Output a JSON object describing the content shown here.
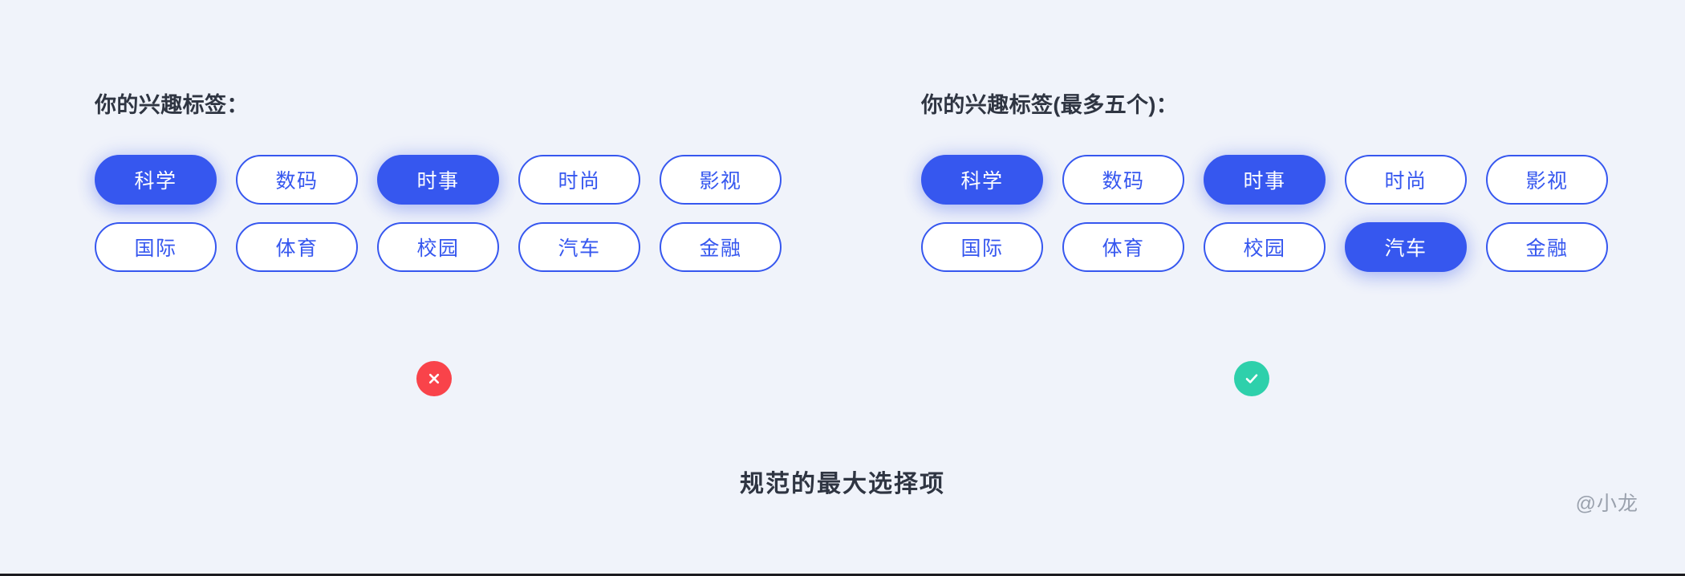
{
  "background_color": "#f0f3fa",
  "accent_color": "#3657ef",
  "caption": "规范的最大选择项",
  "watermark": "@小龙",
  "panels": [
    {
      "id": "invalid",
      "heading": "你的兴趣标签：",
      "verdict": "invalid",
      "verdict_icon": "close-icon",
      "verdict_color": "#f9434a",
      "chips": [
        {
          "label": "科学",
          "selected": true
        },
        {
          "label": "数码",
          "selected": false
        },
        {
          "label": "时事",
          "selected": true
        },
        {
          "label": "时尚",
          "selected": false
        },
        {
          "label": "影视",
          "selected": false
        },
        {
          "label": "国际",
          "selected": false
        },
        {
          "label": "体育",
          "selected": false
        },
        {
          "label": "校园",
          "selected": false
        },
        {
          "label": "汽车",
          "selected": false
        },
        {
          "label": "金融",
          "selected": false
        }
      ]
    },
    {
      "id": "valid",
      "heading": "你的兴趣标签(最多五个)：",
      "verdict": "valid",
      "verdict_icon": "check-icon",
      "verdict_color": "#2ed0ab",
      "chips": [
        {
          "label": "科学",
          "selected": true
        },
        {
          "label": "数码",
          "selected": false
        },
        {
          "label": "时事",
          "selected": true
        },
        {
          "label": "时尚",
          "selected": false
        },
        {
          "label": "影视",
          "selected": false
        },
        {
          "label": "国际",
          "selected": false
        },
        {
          "label": "体育",
          "selected": false
        },
        {
          "label": "校园",
          "selected": false
        },
        {
          "label": "汽车",
          "selected": true
        },
        {
          "label": "金融",
          "selected": false
        }
      ]
    }
  ]
}
